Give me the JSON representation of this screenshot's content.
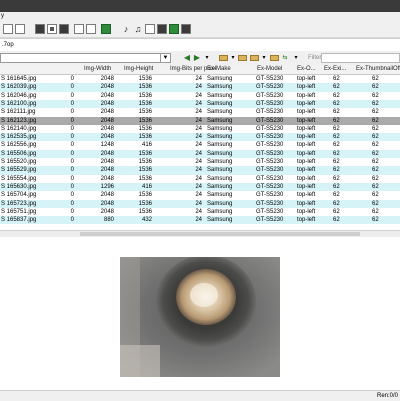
{
  "menu": {
    "first_item": "y"
  },
  "path": {
    "value": ".7op"
  },
  "filter": {
    "label": "Filter"
  },
  "toolbar_icons": [
    "frame-icon",
    "frame-icon",
    "image-icon",
    "image-icon",
    "image-icon",
    "page-icon",
    "film-icon",
    "person-icon",
    "music-note-icon",
    "music-note-icon",
    "film-strip-icon",
    "image-icon",
    "monitor-icon",
    "image-icon"
  ],
  "columns": [
    "Img-Width",
    "Img-Height",
    "Img-Bits per pixel",
    "Ex-Make",
    "Ex-Model",
    "Ex-O...",
    "Ex-Exi...",
    "Ex-ThumbnailOffset"
  ],
  "rows": [
    [
      "S 161645.jpg",
      "0",
      "2048",
      "1536",
      "24",
      "Samsung",
      "GT-S5230",
      "top-left",
      "62",
      "62"
    ],
    [
      "S 162039.jpg",
      "0",
      "2048",
      "1536",
      "24",
      "Samsung",
      "GT-S5230",
      "top-left",
      "62",
      "62"
    ],
    [
      "S 162046.jpg",
      "0",
      "2048",
      "1536",
      "24",
      "Samsung",
      "GT-S5230",
      "top-left",
      "62",
      "62"
    ],
    [
      "S 162100.jpg",
      "0",
      "2048",
      "1536",
      "24",
      "Samsung",
      "GT-S5230",
      "top-left",
      "62",
      "62"
    ],
    [
      "S 162111.jpg",
      "0",
      "2048",
      "1536",
      "24",
      "Samsung",
      "GT-S5230",
      "top-left",
      "62",
      "62"
    ],
    [
      "S 162123.jpg",
      "0",
      "2048",
      "1536",
      "24",
      "Samsung",
      "GT-S5230",
      "top-left",
      "62",
      "62"
    ],
    [
      "S 162140.jpg",
      "0",
      "2048",
      "1536",
      "24",
      "Samsung",
      "GT-S5230",
      "top-left",
      "62",
      "62"
    ],
    [
      "S 162535.jpg",
      "0",
      "2048",
      "1536",
      "24",
      "Samsung",
      "GT-S5230",
      "top-left",
      "62",
      "62"
    ],
    [
      "S 162556.jpg",
      "0",
      "1248",
      "416",
      "24",
      "Samsung",
      "GT-S5230",
      "top-left",
      "62",
      "62"
    ],
    [
      "S 165506.jpg",
      "0",
      "2048",
      "1536",
      "24",
      "Samsung",
      "GT-S5230",
      "top-left",
      "62",
      "62"
    ],
    [
      "S 165520.jpg",
      "0",
      "2048",
      "1536",
      "24",
      "Samsung",
      "GT-S5230",
      "top-left",
      "62",
      "62"
    ],
    [
      "S 165529.jpg",
      "0",
      "2048",
      "1536",
      "24",
      "Samsung",
      "GT-S5230",
      "top-left",
      "62",
      "62"
    ],
    [
      "S 165554.jpg",
      "0",
      "2048",
      "1536",
      "24",
      "Samsung",
      "GT-S5230",
      "top-left",
      "62",
      "62"
    ],
    [
      "S 165630.jpg",
      "0",
      "1296",
      "416",
      "24",
      "Samsung",
      "GT-S5230",
      "top-left",
      "62",
      "62"
    ],
    [
      "S 165704.jpg",
      "0",
      "2048",
      "1536",
      "24",
      "Samsung",
      "GT-S5230",
      "top-left",
      "62",
      "62"
    ],
    [
      "S 165723.jpg",
      "0",
      "2048",
      "1536",
      "24",
      "Samsung",
      "GT-S5230",
      "top-left",
      "62",
      "62"
    ],
    [
      "S 165751.jpg",
      "0",
      "2048",
      "1536",
      "24",
      "Samsung",
      "GT-S5230",
      "top-left",
      "62",
      "62"
    ],
    [
      "S 165837.jpg",
      "0",
      "880",
      "432",
      "24",
      "Samsung",
      "GT-S5230",
      "top-left",
      "62",
      "62"
    ]
  ],
  "selected_row": 5,
  "status": {
    "text": "Ren:0/0"
  },
  "colors": {
    "row_alt": "#d6f4f8",
    "row_selected": "#aaaaaa",
    "title_bar": "#3a3a3a"
  }
}
